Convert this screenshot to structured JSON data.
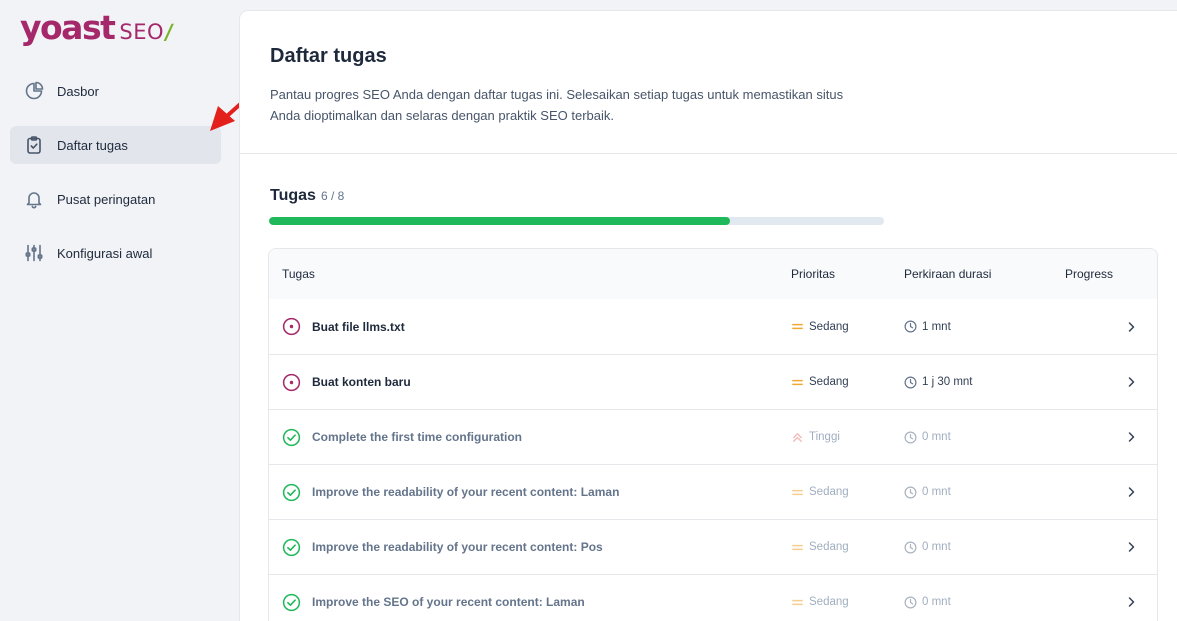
{
  "logo": {
    "brand": "yoast",
    "product": "SEO",
    "slash": "/"
  },
  "sidebar": {
    "items": [
      {
        "label": "Dasbor",
        "icon": "pie-chart-icon"
      },
      {
        "label": "Daftar tugas",
        "icon": "clipboard-check-icon",
        "active": true
      },
      {
        "label": "Pusat peringatan",
        "icon": "bell-icon"
      },
      {
        "label": "Konfigurasi awal",
        "icon": "sliders-icon"
      }
    ]
  },
  "page": {
    "title": "Daftar tugas",
    "description": "Pantau progres SEO Anda dengan daftar tugas ini. Selesaikan setiap tugas untuk memastikan situs Anda dioptimalkan dan selaras dengan praktik SEO terbaik."
  },
  "tasks": {
    "heading": "Tugas",
    "count": "6 / 8",
    "progress_fraction": 0.75,
    "columns": {
      "task": "Tugas",
      "priority": "Prioritas",
      "duration": "Perkiraan durasi",
      "progress": "Progress"
    },
    "rows": [
      {
        "name": "Buat file llms.txt",
        "priority": "Sedang",
        "duration": "1 mnt",
        "done": false
      },
      {
        "name": "Buat konten baru",
        "priority": "Sedang",
        "duration": "1 j 30 mnt",
        "done": false
      },
      {
        "name": "Complete the first time configuration",
        "priority": "Tinggi",
        "duration": "0 mnt",
        "done": true
      },
      {
        "name": "Improve the readability of your recent content: Laman",
        "priority": "Sedang",
        "duration": "0 mnt",
        "done": true
      },
      {
        "name": "Improve the readability of your recent content: Pos",
        "priority": "Sedang",
        "duration": "0 mnt",
        "done": true
      },
      {
        "name": "Improve the SEO of your recent content: Laman",
        "priority": "Sedang",
        "duration": "0 mnt",
        "done": true
      }
    ]
  },
  "colors": {
    "brand": "#a4286a",
    "accent_green": "#77b227",
    "progress": "#1fb85a",
    "medium_priority": "#f0a830",
    "high_priority": "#e5847e",
    "annotation_arrow": "#e3201b"
  }
}
